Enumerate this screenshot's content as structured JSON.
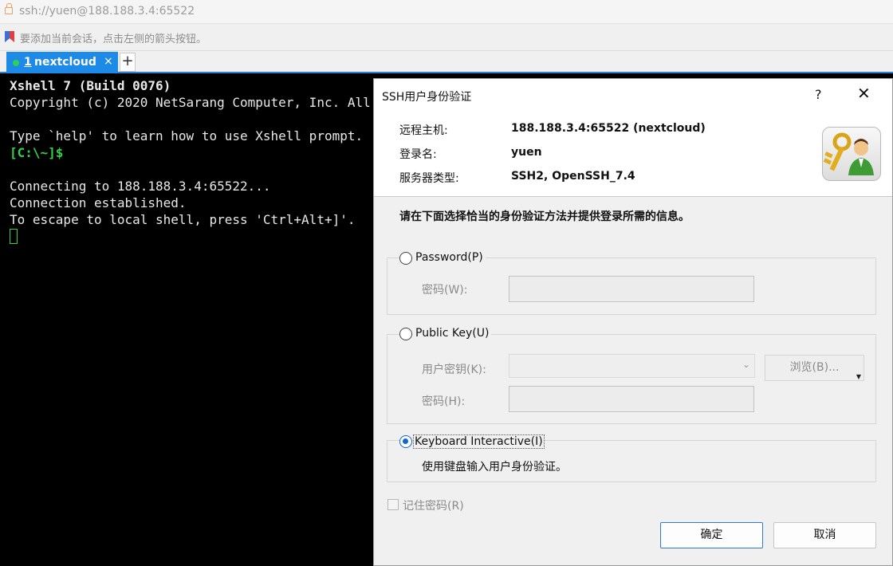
{
  "address_bar": {
    "url": "ssh://yuen@188.188.3.4:65522"
  },
  "hint_bar": {
    "text": "要添加当前会话，点击左侧的箭头按钮。"
  },
  "tabs": [
    {
      "number": "1",
      "name": "nextcloud",
      "close": "×",
      "status_color": "#2ed24f"
    }
  ],
  "new_tab_label": "+",
  "terminal": {
    "lines": [
      "Xshell 7 (Build 0076)",
      "Copyright (c) 2020 NetSarang Computer, Inc. All rights reserved.",
      "",
      "Type `help' to learn how to use Xshell prompt.",
      "[C:\\~]$",
      "",
      "Connecting to 188.188.3.4:65522...",
      "Connection established.",
      "To escape to local shell, press 'Ctrl+Alt+]'."
    ]
  },
  "dialog": {
    "title": "SSH用户身份验证",
    "help": "?",
    "close": "✕",
    "info": {
      "host_label": "远程主机:",
      "host_value": "188.188.3.4:65522 (nextcloud)",
      "login_label": "登录名:",
      "login_value": "yuen",
      "server_type_label": "服务器类型:",
      "server_type_value": "SSH2, OpenSSH_7.4"
    },
    "instruction": "请在下面选择恰当的身份验证方法并提供登录所需的信息。",
    "password_option": {
      "label": "Password(P)",
      "password_label": "密码(W):",
      "password_value": ""
    },
    "publickey_option": {
      "label": "Public Key(U)",
      "user_key_label": "用户密钥(K):",
      "user_key_value": "",
      "browse_label": "浏览(B)...",
      "passphrase_label": "密码(H):",
      "passphrase_value": ""
    },
    "keyboard_option": {
      "label": "Keyboard Interactive(I)",
      "description": "使用键盘输入用户身份验证。",
      "selected": true
    },
    "remember_label": "记住密码(R)",
    "ok_label": "确定",
    "cancel_label": "取消"
  },
  "colors": {
    "accent": "#1e8ae8",
    "terminal_green": "#33d14b",
    "radio_selected": "#1067d2"
  }
}
